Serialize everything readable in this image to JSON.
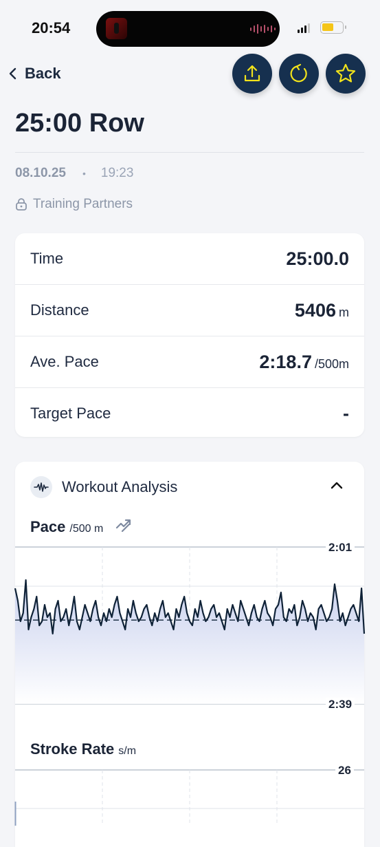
{
  "status_bar": {
    "time": "20:54"
  },
  "header": {
    "back_label": "Back",
    "title": "25:00 Row"
  },
  "meta": {
    "date": "08.10.25",
    "separator": "•",
    "time": "19:23",
    "privacy": "Training Partners"
  },
  "stats": [
    {
      "label": "Time",
      "value": "25:00.0",
      "unit": ""
    },
    {
      "label": "Distance",
      "value": "5406",
      "unit": "m"
    },
    {
      "label": "Ave. Pace",
      "value": "2:18.7",
      "unit": "/500m"
    },
    {
      "label": "Target Pace",
      "value": "-",
      "unit": ""
    }
  ],
  "analysis": {
    "title": "Workout Analysis",
    "pace_chart": {
      "title": "Pace",
      "unit": "/500 m",
      "top_label": "2:01",
      "bottom_label": "2:39"
    },
    "stroke_chart": {
      "title": "Stroke Rate",
      "unit": "s/m",
      "top_label": "26"
    }
  },
  "colors": {
    "accent_button": "#16304f",
    "icon_yellow": "#f2e31b",
    "line": "#0f2237"
  },
  "chart_data": [
    {
      "type": "area",
      "title": "Pace",
      "ylabel": "/500 m",
      "ylim": [
        "2:01",
        "2:39"
      ],
      "reference_line": "2:18.7",
      "x_range": [
        "0:00",
        "25:00"
      ],
      "series": [
        {
          "values_seconds_per_500m": [
            131,
            134,
            139,
            137,
            129,
            141,
            138,
            136,
            133,
            140,
            139,
            135,
            138,
            137,
            142,
            136,
            134,
            139,
            138,
            136,
            140,
            137,
            133,
            139,
            141,
            138,
            135,
            137,
            139,
            136,
            134,
            138,
            140,
            137,
            139,
            136,
            138,
            135,
            133,
            137,
            139,
            141,
            136,
            138,
            134,
            137,
            139,
            138,
            136,
            135,
            138,
            140,
            137,
            139,
            136,
            134,
            138,
            137,
            139,
            141,
            136,
            138,
            135,
            133,
            137,
            139,
            140,
            136,
            138,
            134,
            137,
            139,
            138,
            136,
            135,
            138,
            137,
            139,
            141,
            136,
            138,
            135,
            137,
            139,
            134,
            136,
            138,
            140,
            137,
            135,
            138,
            139,
            136,
            134,
            137,
            138,
            140,
            136,
            135,
            132,
            138,
            139,
            136,
            137,
            135,
            140,
            138,
            134,
            136,
            139,
            137,
            138,
            141,
            136,
            135,
            137,
            139,
            138,
            136,
            130,
            134,
            139,
            137,
            140,
            138,
            136,
            135,
            137,
            139,
            131,
            142
          ]
        }
      ]
    },
    {
      "type": "line",
      "title": "Stroke Rate",
      "ylabel": "s/m",
      "y_top_label": "26",
      "series": [
        {
          "values": []
        }
      ]
    }
  ]
}
